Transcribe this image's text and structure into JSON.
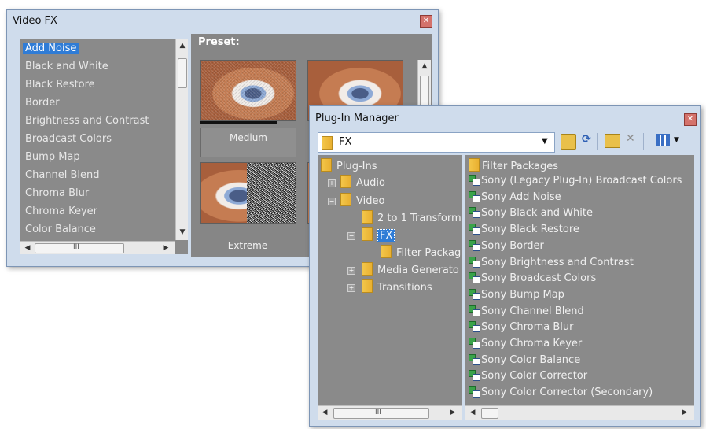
{
  "video_fx": {
    "title": "Video FX",
    "close_glyph": "✕",
    "effects": [
      "Add Noise",
      "Black and White",
      "Black Restore",
      "Border",
      "Brightness and Contrast",
      "Broadcast Colors",
      "Bump Map",
      "Channel Blend",
      "Chroma Blur",
      "Chroma Keyer",
      "Color Balance"
    ],
    "selected_effect": "Add Noise",
    "preset_heading": "Preset:",
    "presets": [
      "Medium",
      "Extreme"
    ],
    "hscroll_grip": "III"
  },
  "plugin_manager": {
    "title": "Plug-In Manager",
    "close_glyph": "✕",
    "path_value": "FX",
    "tree": {
      "root": "Plug-Ins",
      "audio": "Audio",
      "video": "Video",
      "two_to_one": "2 to 1 Transform",
      "fx": "FX",
      "filter_packages": "Filter Packag",
      "media_generators": "Media Generato",
      "transitions": "Transitions"
    },
    "list_folder": "Filter Packages",
    "plugins": [
      "Sony (Legacy Plug-In) Broadcast Colors",
      "Sony Add Noise",
      "Sony Black and White",
      "Sony Black Restore",
      "Sony Border",
      "Sony Brightness and Contrast",
      "Sony Broadcast Colors",
      "Sony Bump Map",
      "Sony Channel Blend",
      "Sony Chroma Blur",
      "Sony Chroma Keyer",
      "Sony Color Balance",
      "Sony Color Corrector",
      "Sony Color Corrector (Secondary)"
    ],
    "hscroll_grip": "III"
  }
}
